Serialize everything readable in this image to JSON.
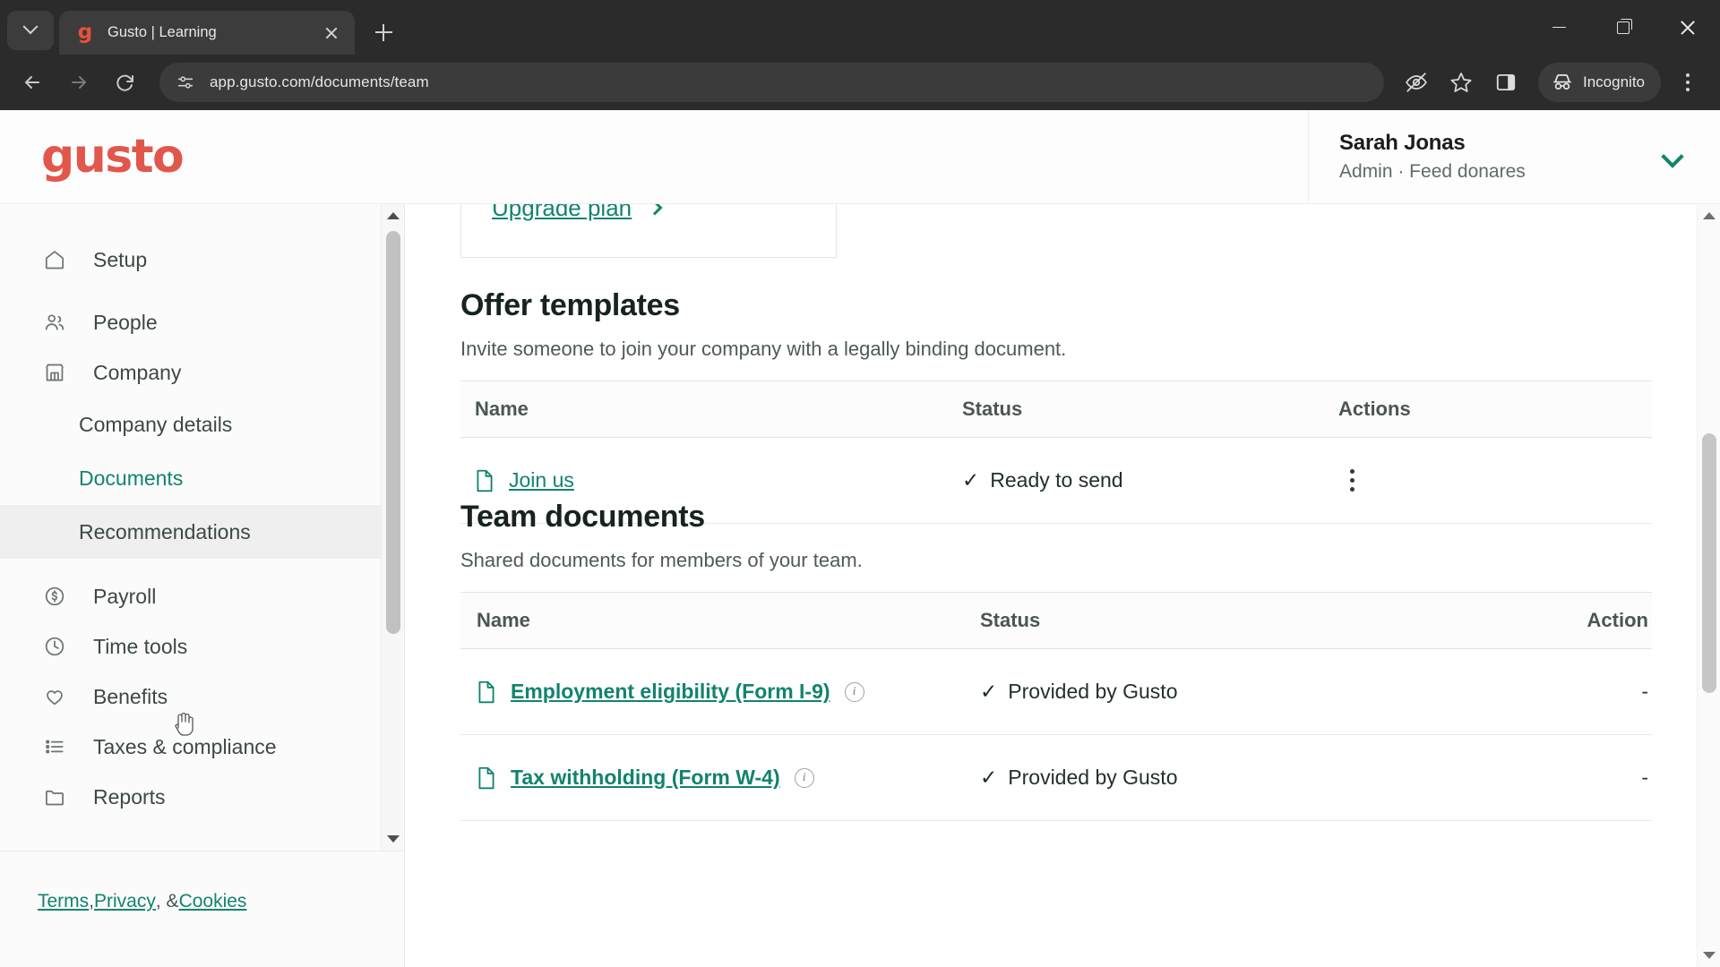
{
  "browser": {
    "tab": {
      "title": "Gusto | Learning",
      "favicon_letter": "g"
    },
    "tab_list_icon": "chevron-down-icon",
    "new_tab_label": "+",
    "url": "app.gusto.com/documents/team",
    "profile_label": "Incognito",
    "icons": {
      "back": "←",
      "forward": "→",
      "reload": "↻",
      "site_info": "tune-icon",
      "eye_off": "eye-off-icon",
      "bookmark": "star-icon",
      "side_panel": "side-panel-icon",
      "incognito": "incognito-icon",
      "menu": "kebab-menu-icon"
    },
    "window": {
      "minimize": "minimize-icon",
      "maximize": "maximize-icon",
      "close": "close-icon"
    }
  },
  "header": {
    "logo": "gusto",
    "user_name": "Sarah Jonas",
    "user_role": "Admin · Feed donares",
    "chevron": "chevron-down-icon"
  },
  "sidebar": {
    "items": [
      {
        "label": "Setup",
        "icon": "home-icon",
        "type": "top"
      },
      {
        "label": "People",
        "icon": "people-icon",
        "type": "top"
      },
      {
        "label": "Company",
        "icon": "store-icon",
        "type": "top"
      },
      {
        "label": "Company details",
        "icon": "",
        "type": "sub"
      },
      {
        "label": "Documents",
        "icon": "",
        "type": "sub-active"
      },
      {
        "label": "Recommendations",
        "icon": "",
        "type": "sub-hover"
      },
      {
        "label": "Payroll",
        "icon": "dollar-circle-icon",
        "type": "top"
      },
      {
        "label": "Time tools",
        "icon": "clock-icon",
        "type": "top"
      },
      {
        "label": "Benefits",
        "icon": "heart-icon",
        "type": "top"
      },
      {
        "label": "Taxes & compliance",
        "icon": "list-icon",
        "type": "top"
      },
      {
        "label": "Reports",
        "icon": "folder-icon",
        "type": "top"
      }
    ],
    "footer": {
      "terms": "Terms",
      "sep1": ", ",
      "privacy": "Privacy",
      "sep2": ", & ",
      "cookies": "Cookies"
    }
  },
  "main": {
    "upgrade_card": {
      "label": "Upgrade plan",
      "chevron": "chevron-right-icon"
    },
    "offer_templates": {
      "title": "Offer templates",
      "subtitle": "Invite someone to join your company with a legally binding document.",
      "columns": [
        "Name",
        "Status",
        "Actions"
      ],
      "rows": [
        {
          "name": "Join us",
          "status": "Ready to send",
          "status_icon": "check-icon",
          "action": "kebab-menu-icon"
        }
      ]
    },
    "team_documents": {
      "title": "Team documents",
      "subtitle": "Shared documents for members of your team.",
      "columns": [
        "Name",
        "Status",
        "Action"
      ],
      "rows": [
        {
          "name": "Employment eligibility (Form I-9)",
          "info": "info-icon",
          "status": "Provided by Gusto",
          "status_icon": "check-icon",
          "action": "-"
        },
        {
          "name": "Tax withholding (Form W-4)",
          "info": "info-icon",
          "status": "Provided by Gusto",
          "status_icon": "check-icon",
          "action": "-"
        }
      ]
    }
  },
  "colors": {
    "brand_red": "#e1574c",
    "teal": "#12836f",
    "active_marker": "#2ec4a6",
    "chrome_bg": "#2b2b2b"
  }
}
